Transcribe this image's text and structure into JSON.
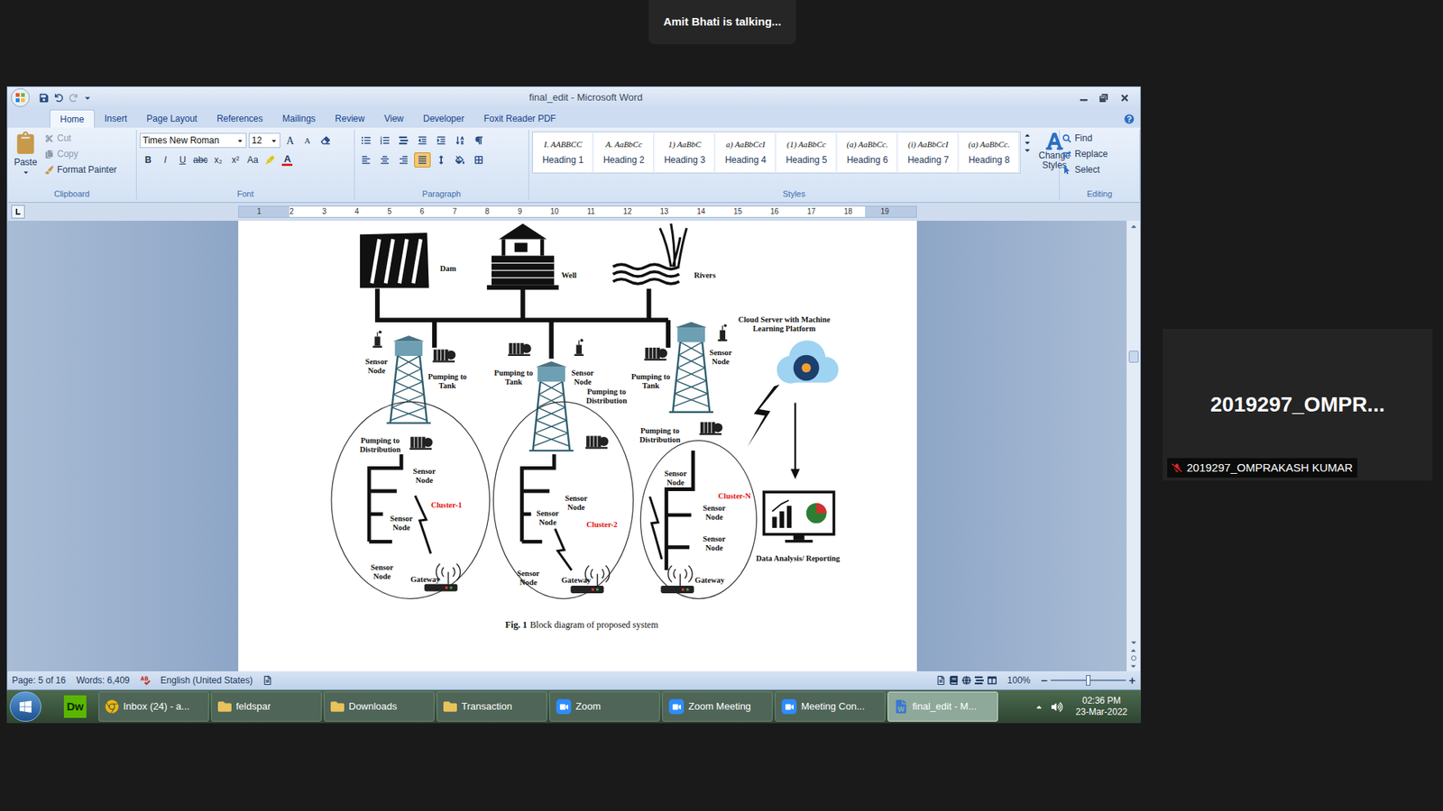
{
  "zoom": {
    "speaker_toast": "Amit Bhati is talking...",
    "participant": {
      "display": "2019297_OMPR...",
      "name": "2019297_OMPRAKASH KUMAR",
      "muted": true
    }
  },
  "word": {
    "title": "final_edit - Microsoft Word",
    "tabs": [
      {
        "label": "Home",
        "selected": true
      },
      {
        "label": "Insert",
        "selected": false
      },
      {
        "label": "Page Layout",
        "selected": false
      },
      {
        "label": "References",
        "selected": false
      },
      {
        "label": "Mailings",
        "selected": false
      },
      {
        "label": "Review",
        "selected": false
      },
      {
        "label": "View",
        "selected": false
      },
      {
        "label": "Developer",
        "selected": false
      },
      {
        "label": "Foxit Reader PDF",
        "selected": false
      }
    ],
    "clipboard": {
      "paste": "Paste",
      "cut": "Cut",
      "copy": "Copy",
      "format_painter": "Format Painter",
      "cut_disabled": true,
      "copy_disabled": true,
      "label": "Clipboard"
    },
    "font": {
      "name": "Times New Roman",
      "size": "12",
      "size_buttons": [
        "A",
        "A"
      ],
      "format_buttons": [
        "B",
        "I",
        "U",
        "abc",
        "x₂",
        "x²",
        "Aa"
      ],
      "color_button": "A",
      "label": "Font"
    },
    "paragraph": {
      "align_buttons": [
        {
          "kind": "left",
          "selected": false
        },
        {
          "kind": "center",
          "selected": false
        },
        {
          "kind": "right",
          "selected": false
        },
        {
          "kind": "justify",
          "selected": true
        }
      ],
      "label": "Paragraph"
    },
    "styles": {
      "items": [
        {
          "preview": "I. AABBCC",
          "name": "Heading 1"
        },
        {
          "preview": "A. AaBbCc",
          "name": "Heading 2"
        },
        {
          "preview": "1) AaBbC",
          "name": "Heading 3"
        },
        {
          "preview": "a) AaBbCcI",
          "name": "Heading 4"
        },
        {
          "preview": "(1) AaBbCc",
          "name": "Heading 5"
        },
        {
          "preview": "(a) AaBbCc.",
          "name": "Heading 6"
        },
        {
          "preview": "(i) AaBbCcI",
          "name": "Heading 7"
        },
        {
          "preview": "(a) AaBbCc.",
          "name": "Heading 8"
        }
      ],
      "change_styles": [
        "Change",
        "Styles"
      ],
      "label": "Styles"
    },
    "editing": {
      "items": [
        "Find",
        "Replace",
        "Select"
      ],
      "label": "Editing"
    },
    "ruler": [
      "1",
      "2",
      "3",
      "4",
      "5",
      "6",
      "7",
      "8",
      "9",
      "10",
      "11",
      "12",
      "13",
      "14",
      "15",
      "16",
      "17",
      "18",
      "19"
    ],
    "figure": {
      "sources": [
        "Dam",
        "Well",
        "Rivers"
      ],
      "cloud": [
        "Cloud Server with Machine",
        "Learning Platform"
      ],
      "clusters": [
        {
          "name": "Cluster-1",
          "tank_sensor": [
            "Sensor",
            "Node"
          ],
          "pump_tank": [
            "Pumping to",
            "Tank"
          ],
          "pump_distribution": [
            "Pumping to",
            "Distribution"
          ],
          "sensors": [
            [
              "Sensor",
              "Node"
            ],
            [
              "Sensor",
              "Node"
            ],
            [
              "Sensor",
              "Node"
            ]
          ],
          "gateway": "Gateway"
        },
        {
          "name": "Cluster-2",
          "tank_sensor": [
            "Sensor",
            "Node"
          ],
          "pump_tank": [
            "Pumping to",
            "Tank"
          ],
          "pump_distribution": [
            "Pumping to",
            "Distribution"
          ],
          "sensors": [
            [
              "Sensor",
              "Node"
            ],
            [
              "Sensor",
              "Node"
            ],
            [
              "Sensor",
              "Node"
            ]
          ],
          "gateway": "Gateway"
        },
        {
          "name": "Cluster-N",
          "tank_sensor": [
            "Sensor",
            "Node"
          ],
          "pump_tank": [
            "Pumping to",
            "Tank"
          ],
          "pump_distribution": [
            "Pumping to",
            "Distribution"
          ],
          "sensors": [
            [
              "Sensor",
              "Node"
            ],
            [
              "Sensor",
              "Node"
            ],
            [
              "Sensor",
              "Node"
            ]
          ],
          "gateway": "Gateway"
        }
      ],
      "report": "Data Analysis/ Reporting",
      "caption": {
        "number": "Fig. 1",
        "text": "Block diagram of proposed system"
      }
    },
    "status_bar": {
      "page": "Page: 5 of 16",
      "words": "Words: 6,409",
      "language": "English (United States)",
      "zoom": "100%",
      "zoom_level": 0.5
    }
  },
  "taskbar": {
    "pinned": {
      "label": "Dw"
    },
    "items": [
      {
        "label": "Inbox (24) - a...",
        "kind": "chrome",
        "selected": false
      },
      {
        "label": "feldspar",
        "kind": "folder",
        "selected": false
      },
      {
        "label": "Downloads",
        "kind": "folder",
        "selected": false
      },
      {
        "label": "Transaction",
        "kind": "folder",
        "selected": false
      },
      {
        "label": "Zoom",
        "kind": "zoom",
        "selected": false
      },
      {
        "label": "Zoom Meeting",
        "kind": "zoom",
        "selected": false
      },
      {
        "label": "Meeting Con...",
        "kind": "zoom",
        "selected": false
      },
      {
        "label": "final_edit - M...",
        "kind": "word",
        "selected": true
      }
    ],
    "clock": {
      "time": "02:36 PM",
      "date": "23-Mar-2022"
    }
  }
}
